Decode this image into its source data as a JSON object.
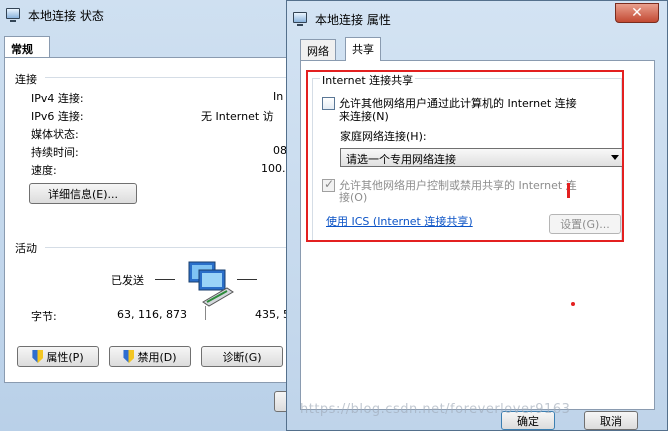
{
  "status_window": {
    "title": "本地连接 状态",
    "tab": "常规",
    "connection": {
      "group_label": "连接",
      "rows": [
        {
          "label": "IPv4 连接:",
          "value": "In"
        },
        {
          "label": "IPv6 连接:",
          "value": "无 Internet 访"
        },
        {
          "label": "媒体状态:",
          "value": ""
        },
        {
          "label": "持续时间:",
          "value": "08"
        },
        {
          "label": "速度:",
          "value": "100."
        }
      ],
      "details_button": "详细信息(E)..."
    },
    "activity": {
      "group_label": "活动",
      "sent_label": "已发送",
      "bytes_label": "字节:",
      "bytes_sent": "63, 116, 873",
      "bytes_received": "435, 5"
    },
    "buttons": {
      "properties": "属性(P)",
      "disable": "禁用(D)",
      "diagnose": "诊断(G)"
    }
  },
  "properties_window": {
    "title": "本地连接 属性",
    "close": "✕",
    "tabs": [
      {
        "label": "网络",
        "active": false
      },
      {
        "label": "共享",
        "active": true
      }
    ],
    "ics_group": {
      "legend": "Internet 连接共享",
      "allow_share": {
        "label_line1": "允许其他网络用户通过此计算机的 Internet 连接",
        "label_line2": "来连接(N)",
        "checked": false
      },
      "home_network_label": "家庭网络连接(H):",
      "home_network_value": "请选一个专用网络连接",
      "allow_control": {
        "label_line1": "允许其他网络用户控制或禁用共享的 Internet 连",
        "label_line2": "接(O)",
        "checked": true,
        "disabled": true
      },
      "ics_link": "使用 ICS (Internet 连接共享)",
      "settings_button": "设置(G)..."
    },
    "ok": "确定",
    "cancel": "取消"
  },
  "watermark": "https://blog.csdn.net/foreverlover9163",
  "colors": {
    "annotation": "#e32020",
    "link": "#0b53c6"
  }
}
